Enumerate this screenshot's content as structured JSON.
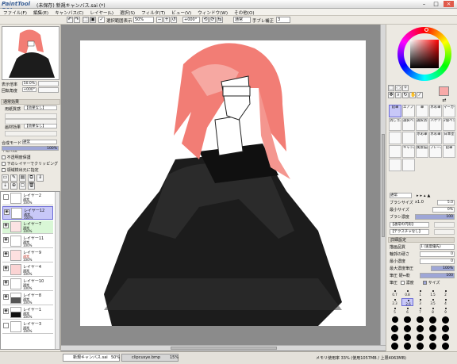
{
  "window": {
    "logo": "PaintTool SAI",
    "title": "(未保存) 新規キャンバス.sai (*)"
  },
  "menu": [
    "ファイル(F)",
    "編集(E)",
    "キャンバス(C)",
    "レイヤー(L)",
    "選択(S)",
    "フィルタ(T)",
    "ビュー(V)",
    "ウィンドウ(W)",
    "その他(O)"
  ],
  "toolbar": {
    "show_selection": "選択範囲表示",
    "zoom": "50%",
    "angle": "+000°",
    "blend": "通常",
    "stabilizer_label": "手ブレ補正",
    "stabilizer": "3"
  },
  "navigator": {
    "zoom_label": "表示倍率",
    "zoom": "50.0%",
    "angle_label": "回転角度",
    "angle": "+000°"
  },
  "layer_effects": {
    "section": "通常効果",
    "texture_label": "用紙質感",
    "texture_value": "【効果なし】",
    "effect_label": "画材効果",
    "effect_value": "【効果なし】"
  },
  "layer_props": {
    "blend_label": "合成モード",
    "blend": "通常",
    "opacity_label": "不透明度",
    "opacity": "100%",
    "protect": "不透明度保護",
    "clip": "下のレイヤーでクリッピング",
    "ref": "領域検出元に指定"
  },
  "layers": [
    {
      "name": "レイヤー2",
      "mode": "通常",
      "opacity": "100%",
      "selected": false,
      "green": false
    },
    {
      "name": "レイヤー12",
      "mode": "通常",
      "opacity": "100%",
      "selected": true,
      "green": false
    },
    {
      "name": "レイヤー7",
      "mode": "通常",
      "opacity": "100%",
      "selected": false,
      "green": true
    },
    {
      "name": "レイヤー11",
      "mode": "通常",
      "opacity": "100%",
      "selected": false,
      "green": false
    },
    {
      "name": "レイヤー9",
      "mode": "通常",
      "opacity": "100%",
      "selected": false,
      "green": false
    },
    {
      "name": "レイヤー4",
      "mode": "通常",
      "opacity": "100%",
      "selected": false,
      "green": false
    },
    {
      "name": "レイヤー10",
      "mode": "通常",
      "opacity": "100%",
      "selected": false,
      "green": false
    },
    {
      "name": "レイヤー8",
      "mode": "通常",
      "opacity": "100%",
      "selected": false,
      "green": false
    },
    {
      "name": "レイヤー1",
      "mode": "通常",
      "opacity": "100%",
      "selected": false,
      "green": false
    },
    {
      "name": "レイヤー3",
      "mode": "通常",
      "opacity": "100%",
      "selected": false,
      "green": false
    }
  ],
  "tools": [
    "鉛筆",
    "エアブラシ",
    "筆",
    "水彩筆",
    "マーカー",
    "消しゴム",
    "選択ペン",
    "選択消し",
    "バケツ",
    "2値ペン",
    "",
    "",
    "水彩筆",
    "水彩筆",
    "日本塗",
    "",
    "キャンパス",
    "風景描画",
    "フレーム",
    "鉛筆",
    "",
    ""
  ],
  "brush": {
    "mode": "通常",
    "size_label": "ブラシサイズ",
    "size_mult": "x1.0",
    "size": "5.0",
    "min_label": "最小サイズ",
    "min": "0%",
    "density_label": "ブラシ濃度",
    "density": "100",
    "shape_label": "【通常の円形】",
    "texture_label": "【テクスチャなし】",
    "detail_label": "詳細設定",
    "quality_label": "描画品質",
    "quality": "1 (速度優先)",
    "edge_label": "輪郭の硬さ",
    "edge": "0",
    "min_density_label": "最小濃度",
    "min_density": "0",
    "max_density_label": "最大濃度筆圧",
    "max_density": "100%",
    "pressure_label": "筆圧 硬⇔軟",
    "pressure": "100",
    "pressure_density": "濃度",
    "pressure_size": "サイズ"
  },
  "size_presets": [
    "0.7",
    "0.8",
    "1",
    "1.5",
    "2",
    "2.3",
    "2.6",
    "3",
    "3.5",
    "4",
    "5",
    "6",
    "7",
    "8",
    "9"
  ],
  "status": {
    "tab1": "新規キャンバス.sai",
    "tab1_zoom": "50%",
    "tab2": "clipcusye.bmp",
    "tab2_zoom": "15%",
    "memory": "メモリ使用率 33% (使用1057MB / 上限4063MB)"
  },
  "colors": {
    "accent": "#6b6bd6",
    "current_color": "#f8aaa8",
    "hair": "#f27d75",
    "cloak": "#1c1c1c"
  }
}
